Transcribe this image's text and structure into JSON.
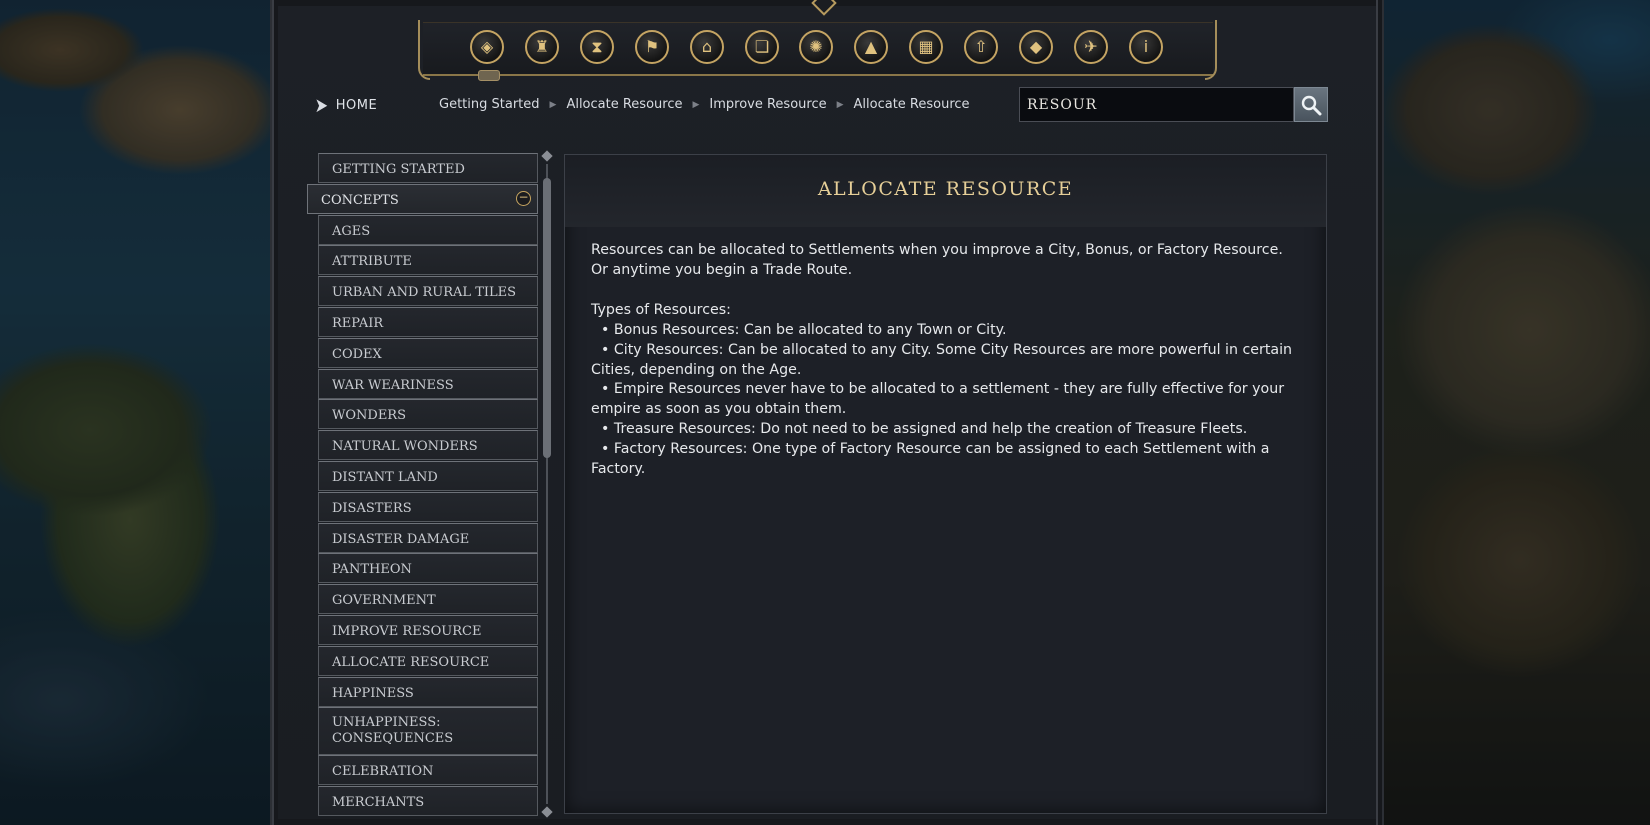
{
  "top_icons": [
    {
      "name": "civilization-icon",
      "glyph": "◈"
    },
    {
      "name": "trophy-icon",
      "glyph": "♜"
    },
    {
      "name": "hourglass-icon",
      "glyph": "⧗"
    },
    {
      "name": "flag-icon",
      "glyph": "⚑"
    },
    {
      "name": "government-building-icon",
      "glyph": "⌂"
    },
    {
      "name": "book-icon",
      "glyph": "❏"
    },
    {
      "name": "atom-icon",
      "glyph": "✺"
    },
    {
      "name": "mountains-icon",
      "glyph": "▲"
    },
    {
      "name": "city-icon",
      "glyph": "▦"
    },
    {
      "name": "upgrade-arrow-icon",
      "glyph": "⇧"
    },
    {
      "name": "resource-pyramid-icon",
      "glyph": "◆"
    },
    {
      "name": "dove-icon",
      "glyph": "✈"
    },
    {
      "name": "info-icon",
      "glyph": "i"
    }
  ],
  "home": {
    "label": "HOME"
  },
  "breadcrumb": [
    "Getting Started",
    "Allocate Resource",
    "Improve Resource",
    "Allocate Resource"
  ],
  "search": {
    "value": "RESOUR"
  },
  "sidebar": [
    {
      "label": "GETTING STARTED",
      "state": "normal"
    },
    {
      "label": "CONCEPTS",
      "state": "active"
    },
    {
      "label": "AGES",
      "state": "normal"
    },
    {
      "label": "ATTRIBUTE",
      "state": "normal"
    },
    {
      "label": "URBAN AND RURAL TILES",
      "state": "normal"
    },
    {
      "label": "REPAIR",
      "state": "normal"
    },
    {
      "label": "CODEX",
      "state": "normal"
    },
    {
      "label": "WAR WEARINESS",
      "state": "normal"
    },
    {
      "label": "WONDERS",
      "state": "normal"
    },
    {
      "label": "NATURAL WONDERS",
      "state": "normal"
    },
    {
      "label": "DISTANT LAND",
      "state": "normal"
    },
    {
      "label": "DISASTERS",
      "state": "normal"
    },
    {
      "label": "DISASTER DAMAGE",
      "state": "normal"
    },
    {
      "label": "PANTHEON",
      "state": "normal"
    },
    {
      "label": "GOVERNMENT",
      "state": "normal"
    },
    {
      "label": "IMPROVE RESOURCE",
      "state": "normal"
    },
    {
      "label": "ALLOCATE RESOURCE",
      "state": "normal"
    },
    {
      "label": "HAPPINESS",
      "state": "normal"
    },
    {
      "label": "UNHAPPINESS: CONSEQUENCES",
      "state": "double"
    },
    {
      "label": "CELEBRATION",
      "state": "normal"
    },
    {
      "label": "MERCHANTS",
      "state": "normal"
    }
  ],
  "content": {
    "title": "ALLOCATE RESOURCE",
    "intro_1": "Resources can be allocated to Settlements when you improve a City, Bonus, or Factory Resource.",
    "intro_2": "Or anytime you begin a Trade Route.",
    "types_heading": "Types of Resources:",
    "bullets": [
      "• Bonus Resources: Can be allocated to any Town or City.",
      "• City Resources: Can be allocated to any City. Some City Resources are more powerful in certain",
      "Cities, depending on the Age.",
      "•  Empire Resources never have to be allocated to a settlement - they are fully effective for your",
      "empire as soon as you obtain them.",
      "• Treasure Resources: Do not need to be assigned and help the creation of Treasure Fleets.",
      "• Factory Resources: One type of Factory Resource can be assigned to each Settlement with a",
      "Factory."
    ]
  },
  "colors": {
    "gold_accent": "#c4a463",
    "title_gold": "#e6cf98",
    "panel_bg": "#1d2027"
  }
}
